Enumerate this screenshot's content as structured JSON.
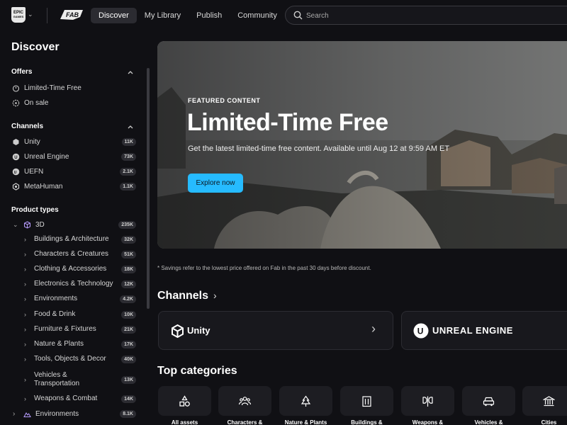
{
  "topbar": {
    "epic_logo_text": [
      "EPIC",
      "GAMES"
    ],
    "nav": [
      {
        "label": "Discover",
        "active": true
      },
      {
        "label": "My Library",
        "active": false
      },
      {
        "label": "Publish",
        "active": false
      },
      {
        "label": "Community",
        "active": false
      }
    ],
    "search_placeholder": "Search"
  },
  "sidebar": {
    "title": "Discover",
    "offers": {
      "heading": "Offers",
      "items": [
        {
          "label": "Limited-Time Free",
          "icon": "timer-icon"
        },
        {
          "label": "On sale",
          "icon": "sale-tag-icon"
        }
      ]
    },
    "channels": {
      "heading": "Channels",
      "items": [
        {
          "label": "Unity",
          "badge": "11K",
          "icon": "unity-icon"
        },
        {
          "label": "Unreal Engine",
          "badge": "73K",
          "icon": "unreal-icon"
        },
        {
          "label": "UEFN",
          "badge": "2.1K",
          "icon": "uefn-icon"
        },
        {
          "label": "MetaHuman",
          "badge": "1.1K",
          "icon": "metahuman-icon"
        }
      ]
    },
    "product_types": {
      "heading": "Product types",
      "top": {
        "label": "3D",
        "badge": "235K"
      },
      "subs": [
        {
          "label": "Buildings & Architecture",
          "badge": "32K"
        },
        {
          "label": "Characters & Creatures",
          "badge": "51K"
        },
        {
          "label": "Clothing & Accessories",
          "badge": "18K"
        },
        {
          "label": "Electronics & Technology",
          "badge": "12K"
        },
        {
          "label": "Environments",
          "badge": "4.2K"
        },
        {
          "label": "Food & Drink",
          "badge": "10K"
        },
        {
          "label": "Furniture & Fixtures",
          "badge": "21K"
        },
        {
          "label": "Nature & Plants",
          "badge": "17K"
        },
        {
          "label": "Tools, Objects & Decor",
          "badge": "40K"
        },
        {
          "label": "Vehicles &",
          "label2": "Transportation",
          "badge": "13K"
        },
        {
          "label": "Weapons & Combat",
          "badge": "14K"
        }
      ],
      "next": {
        "label": "Environments",
        "badge": "8.1K"
      }
    }
  },
  "hero": {
    "eyebrow": "FEATURED CONTENT",
    "title": "Limited-Time Free",
    "subtitle": "Get the latest limited-time free content. Available until Aug 12 at 9:59 AM ET",
    "button": "Explore now"
  },
  "savings_note": "* Savings refer to the lowest price offered on Fab in the past 30 days before discount.",
  "channels_heading": "Channels",
  "channel_cards": [
    {
      "name": "Unity"
    },
    {
      "name": "UNREAL ENGINE"
    }
  ],
  "top_categories_heading": "Top categories",
  "categories": [
    {
      "label": "All assets",
      "icon": "shapes-icon"
    },
    {
      "label": "Characters &",
      "icon": "people-icon"
    },
    {
      "label": "Nature & Plants",
      "icon": "tree-icon"
    },
    {
      "label": "Buildings &",
      "icon": "building-icon"
    },
    {
      "label": "Weapons &",
      "icon": "axe-icon"
    },
    {
      "label": "Vehicles &",
      "icon": "car-icon"
    },
    {
      "label": "Cities",
      "icon": "bank-icon"
    }
  ],
  "colors": {
    "accent": "#26bbff",
    "background": "#101014",
    "card": "#18181d",
    "badge": "#2c2c32"
  }
}
